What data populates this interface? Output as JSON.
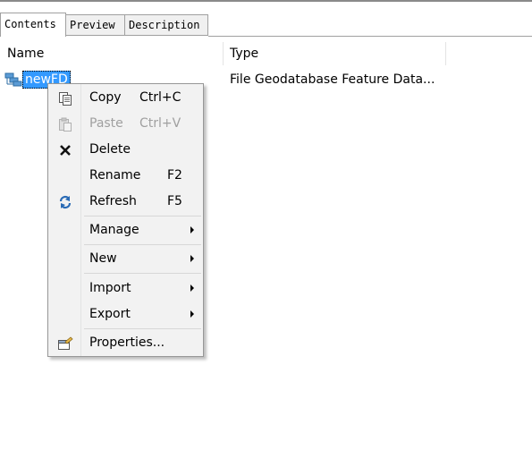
{
  "tabs": [
    {
      "label": "Contents"
    },
    {
      "label": "Preview"
    },
    {
      "label": "Description"
    }
  ],
  "columns": {
    "name": "Name",
    "type": "Type"
  },
  "dataset": {
    "name": "newFD",
    "type": "File Geodatabase Feature Data...",
    "icon": "feature-dataset-icon"
  },
  "context_menu": {
    "copy": {
      "label": "Copy",
      "shortcut": "Ctrl+C",
      "icon": "copy-icon"
    },
    "paste": {
      "label": "Paste",
      "shortcut": "Ctrl+V",
      "icon": "paste-icon",
      "enabled": false
    },
    "delete": {
      "label": "Delete",
      "icon": "delete-icon"
    },
    "rename": {
      "label": "Rename",
      "shortcut": "F2"
    },
    "refresh": {
      "label": "Refresh",
      "shortcut": "F5",
      "icon": "refresh-icon"
    },
    "manage": {
      "label": "Manage"
    },
    "new": {
      "label": "New"
    },
    "import": {
      "label": "Import"
    },
    "export": {
      "label": "Export"
    },
    "properties": {
      "label": "Properties...",
      "icon": "properties-icon"
    }
  },
  "colors": {
    "selection": "#3399ff",
    "menu_bg": "#f2f2f2"
  }
}
